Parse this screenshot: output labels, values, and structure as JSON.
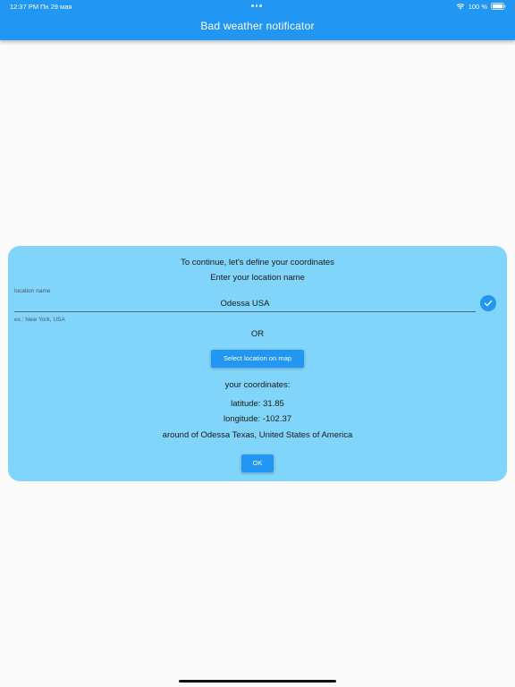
{
  "status_bar": {
    "time": "12:37 PM",
    "date": "Пн 29 мая",
    "battery": "100 %",
    "icons": [
      "wifi-icon",
      "battery-icon"
    ]
  },
  "app_bar": {
    "title": "Bad weather notificator",
    "color": "#2196f3"
  },
  "dialog": {
    "background": "#81d4fa",
    "intro": "To continue, let's define your coordinates",
    "prompt": "Enter your location name",
    "location_field": {
      "label": "location name",
      "value": "Odessa USA",
      "helper": "ex.: New York, USA"
    },
    "confirm_icon": "check-icon",
    "or_text": "OR",
    "map_button_label": "Select location on map",
    "coords_header": "your coordinates:",
    "latitude": "latitude: 31.85",
    "longitude": "longitude: -102.37",
    "place": "around of Odessa Texas, United States of America",
    "ok_label": "OK"
  }
}
